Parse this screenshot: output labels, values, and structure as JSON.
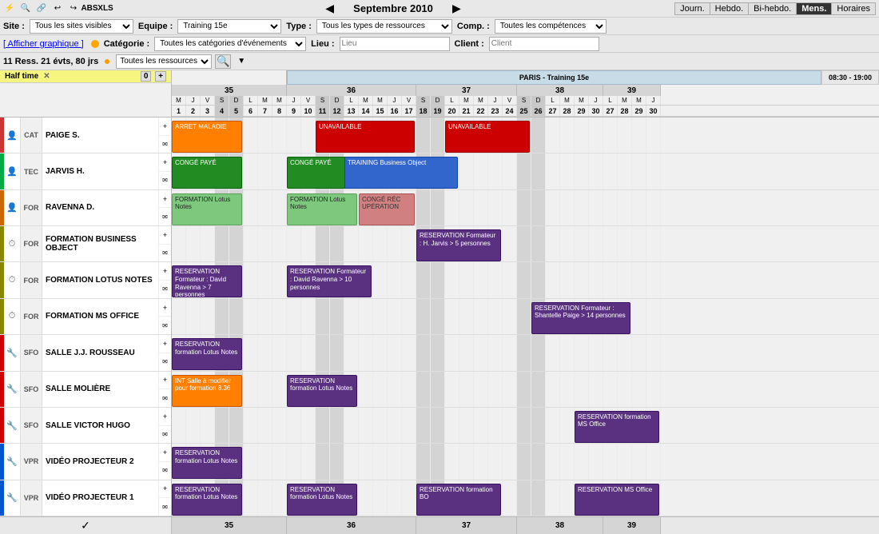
{
  "toolbar": {
    "icons": [
      "⚡",
      "🔍",
      "🔗",
      "↩",
      "↪",
      "ABS",
      "XLS"
    ],
    "nav_prev": "◀",
    "nav_next": "▶",
    "month": "Septembre 2010",
    "views": [
      "Journ.",
      "Hebdo.",
      "Bi-hebdo.",
      "Mens.",
      "Horaires"
    ],
    "active_view": "Mens."
  },
  "filters": {
    "site_label": "Site :",
    "site_value": "Tous les sites visibles",
    "equipe_label": "Equipe :",
    "equipe_value": "Training 15e",
    "type_label": "Type :",
    "type_value": "Tous les types de ressources",
    "comp_label": "Comp. :",
    "comp_value": "Toutes les compétences",
    "graphique_label": "[ Afficher graphique ]",
    "categorie_label": "Catégorie :",
    "categorie_value": "Toutes les catégories d'événements",
    "lieu_label": "Lieu :",
    "lieu_value": "Lieu",
    "client_label": "Client :",
    "client_value": "Client"
  },
  "resource_bar": {
    "count": "11 Ress.",
    "events": "21 évts, 80 jrs",
    "all_resources": "Toutes les ressources"
  },
  "weeks": [
    {
      "num": "35",
      "days": [
        {
          "name": "M",
          "num": "1",
          "type": "normal"
        },
        {
          "name": "J",
          "num": "2",
          "type": "normal"
        },
        {
          "name": "V",
          "num": "3",
          "type": "normal"
        },
        {
          "name": "S",
          "num": "4",
          "type": "weekend"
        },
        {
          "name": "D",
          "num": "5",
          "type": "weekend"
        },
        {
          "name": "L",
          "num": "6",
          "type": "normal"
        },
        {
          "name": "M",
          "num": "7",
          "type": "normal"
        },
        {
          "name": "M",
          "num": "8",
          "type": "normal"
        }
      ]
    },
    {
      "num": "36",
      "days": [
        {
          "name": "J",
          "num": "9",
          "type": "normal"
        },
        {
          "name": "V",
          "num": "10",
          "type": "normal"
        },
        {
          "name": "S",
          "num": "11",
          "type": "weekend"
        },
        {
          "name": "D",
          "num": "12",
          "type": "weekend"
        },
        {
          "name": "L",
          "num": "13",
          "type": "normal"
        },
        {
          "name": "M",
          "num": "14",
          "type": "normal"
        },
        {
          "name": "M",
          "num": "15",
          "type": "normal"
        },
        {
          "name": "J",
          "num": "16",
          "type": "normal"
        },
        {
          "name": "V",
          "num": "17",
          "type": "normal"
        }
      ]
    },
    {
      "num": "37",
      "days": [
        {
          "name": "S",
          "num": "18",
          "type": "weekend"
        },
        {
          "name": "D",
          "num": "19",
          "type": "weekend"
        },
        {
          "name": "L",
          "num": "20",
          "type": "normal"
        },
        {
          "name": "M",
          "num": "21",
          "type": "normal"
        },
        {
          "name": "M",
          "num": "22",
          "type": "normal"
        },
        {
          "name": "J",
          "num": "23",
          "type": "normal"
        },
        {
          "name": "V",
          "num": "24",
          "type": "normal"
        }
      ]
    },
    {
      "num": "38",
      "days": [
        {
          "name": "S",
          "num": "25",
          "type": "weekend"
        },
        {
          "name": "D",
          "num": "26",
          "type": "weekend"
        },
        {
          "name": "L",
          "num": "27",
          "type": "normal"
        },
        {
          "name": "M",
          "num": "28",
          "type": "normal"
        },
        {
          "name": "M",
          "num": "29",
          "type": "normal"
        },
        {
          "name": "J",
          "num": "30",
          "type": "normal"
        }
      ]
    },
    {
      "num": "39",
      "days": [
        {
          "name": "L",
          "num": "27",
          "type": "normal"
        },
        {
          "name": "M",
          "num": "28",
          "type": "normal"
        },
        {
          "name": "M",
          "num": "29",
          "type": "normal"
        },
        {
          "name": "J",
          "num": "30",
          "type": "normal"
        }
      ]
    }
  ],
  "resources": [
    {
      "colorbar": "#cc0000",
      "icon": "👤",
      "badge": "CAT",
      "name": "PAIGE S.",
      "type": "person",
      "events": [
        {
          "label": "ARRET MALADIE",
          "class": "event-orange",
          "week": 0,
          "start": 0,
          "span": 5
        },
        {
          "label": "UNAVAILABLE",
          "class": "event-red",
          "week": 1,
          "start": 2,
          "span": 6
        },
        {
          "label": "UNAVAILABLE",
          "class": "event-red",
          "week": 2,
          "start": 2,
          "span": 5
        }
      ]
    },
    {
      "colorbar": "#00aa00",
      "icon": "👤",
      "badge": "TEC",
      "name": "JARVIS H.",
      "type": "person",
      "events": [
        {
          "label": "CONGÉ PAYÉ",
          "class": "event-green",
          "week": 0,
          "start": 0,
          "span": 5
        },
        {
          "label": "CONGÉ PAYÉ",
          "class": "event-green",
          "week": 1,
          "start": 0,
          "span": 5
        },
        {
          "label": "TRAINING Business Object",
          "class": "event-blue",
          "week": 1,
          "start": 4,
          "span": 7
        }
      ]
    },
    {
      "colorbar": "#cc6600",
      "icon": "👤",
      "badge": "FOR",
      "name": "RAVENNA D.",
      "type": "person",
      "events": [
        {
          "label": "FORMATION Lotus Notes",
          "class": "event-lightgreen",
          "week": 0,
          "start": 0,
          "span": 5
        },
        {
          "label": "FORMATION Lotus Notes",
          "class": "event-lightgreen",
          "week": 1,
          "start": 0,
          "span": 4
        },
        {
          "label": "CONGÉ RÉC UPÉRATION",
          "class": "event-pink",
          "week": 1,
          "start": 4,
          "span": 3
        }
      ]
    },
    {
      "colorbar": "#888800",
      "icon": "⏱",
      "badge": "FOR",
      "name": "FORMATION BUSINESS OBJECT",
      "type": "activity",
      "events": [
        {
          "label": "RESERVATION Formateur : H. Jarvis > 5 personnes",
          "class": "event-purple",
          "week": 2,
          "start": 0,
          "span": 5
        }
      ]
    },
    {
      "colorbar": "#888800",
      "icon": "⏱",
      "badge": "FOR",
      "name": "FORMATION LOTUS NOTES",
      "type": "activity",
      "events": [
        {
          "label": "RESERVATION Formateur : David Ravenna > 7 personnes",
          "class": "event-purple",
          "week": 0,
          "start": 0,
          "span": 5
        },
        {
          "label": "RESERVATION Formateur : David Ravenna > 10 personnes",
          "class": "event-purple",
          "week": 1,
          "start": 0,
          "span": 5
        }
      ]
    },
    {
      "colorbar": "#888800",
      "icon": "⏱",
      "badge": "FOR",
      "name": "FORMATION MS OFFICE",
      "type": "activity",
      "events": [
        {
          "label": "RESERVATION Formateur : Shantelle Paige > 14 personnes",
          "class": "event-purple",
          "week": 3,
          "start": 0,
          "span": 6
        }
      ]
    },
    {
      "colorbar": "#cc0000",
      "icon": "🔧",
      "badge": "SFO",
      "name": "SALLE J.J. ROUSSEAU",
      "type": "room",
      "events": [
        {
          "label": "RESERVATION formation Lotus Notes",
          "class": "event-purple",
          "week": 0,
          "start": 0,
          "span": 5
        }
      ]
    },
    {
      "colorbar": "#cc0000",
      "icon": "🔧",
      "badge": "SFO",
      "name": "SALLE MOLIÈRE",
      "type": "room",
      "events": [
        {
          "label": "INT Salle à modifier pour formation 8.36",
          "class": "event-orange",
          "week": 0,
          "start": 0,
          "span": 5
        },
        {
          "label": "RESERVATION formation Lotus Notes",
          "class": "event-purple",
          "week": 1,
          "start": 0,
          "span": 4
        }
      ]
    },
    {
      "colorbar": "#cc0000",
      "icon": "🔧",
      "badge": "SFO",
      "name": "SALLE VICTOR HUGO",
      "type": "room",
      "events": [
        {
          "label": "RESERVATION formation MS Office",
          "class": "event-purple",
          "week": 3,
          "start": 2,
          "span": 4
        }
      ]
    },
    {
      "colorbar": "#0000cc",
      "icon": "🔧",
      "badge": "VPR",
      "name": "VIDÉO PROJECTEUR 2",
      "type": "equipment",
      "events": [
        {
          "label": "RESERVATION formation Lotus Notes",
          "class": "event-purple",
          "week": 0,
          "start": 0,
          "span": 5
        }
      ]
    },
    {
      "colorbar": "#0000cc",
      "icon": "🔧",
      "badge": "VPR",
      "name": "VIDÉO PROJECTEUR 1",
      "type": "equipment",
      "events": [
        {
          "label": "RESERVATION formation Lotus Notes",
          "class": "event-purple",
          "week": 0,
          "start": 0,
          "span": 5
        },
        {
          "label": "RESERVATION formation Lotus Notes",
          "class": "event-purple",
          "week": 1,
          "start": 0,
          "span": 4
        },
        {
          "label": "RESERVATION formation BO",
          "class": "event-purple",
          "week": 2,
          "start": 0,
          "span": 5
        },
        {
          "label": "RESERVATION MS Office",
          "class": "event-purple",
          "week": 3,
          "start": 2,
          "span": 4
        }
      ]
    }
  ],
  "bottom": {
    "check_icon": "✓",
    "weeks": [
      "35",
      "36",
      "37",
      "38",
      "39"
    ]
  },
  "paris_banner": "PARIS - Training 15e",
  "time_banner": "08:30 - 19:00",
  "halftime": "Half time"
}
